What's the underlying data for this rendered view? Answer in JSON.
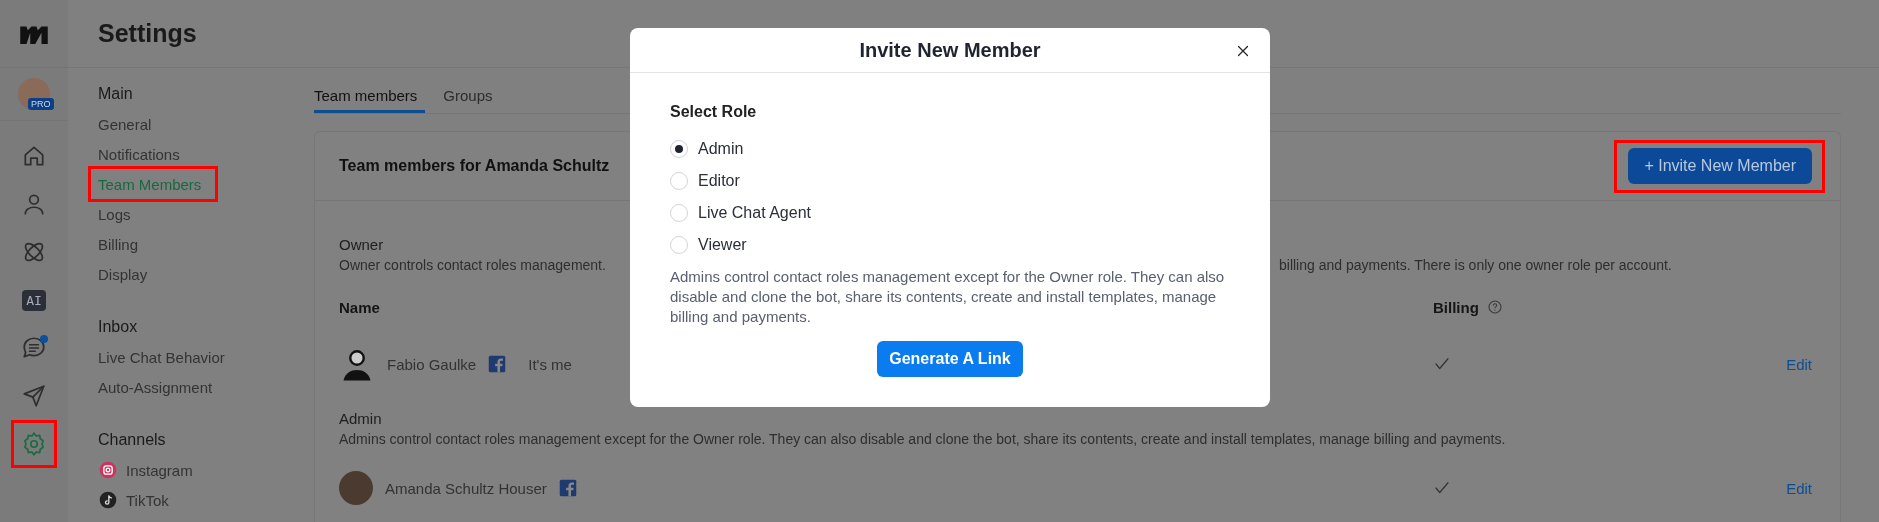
{
  "rail": {
    "avatar": {
      "badge": "PRO"
    },
    "items": [
      {
        "kind": "home",
        "selected": false,
        "highlighted": false,
        "notification": false
      },
      {
        "kind": "person",
        "selected": false,
        "highlighted": false,
        "notification": false
      },
      {
        "kind": "atom",
        "selected": false,
        "highlighted": false,
        "notification": false
      },
      {
        "kind": "ai",
        "label": "AI",
        "selected": false,
        "highlighted": false,
        "notification": false
      },
      {
        "kind": "chat",
        "selected": false,
        "highlighted": false,
        "notification": true
      },
      {
        "kind": "send",
        "selected": false,
        "highlighted": false,
        "notification": false
      },
      {
        "kind": "settings",
        "selected": true,
        "highlighted": true,
        "notification": false
      }
    ]
  },
  "page_title": "Settings",
  "settings_nav": [
    {
      "title": "Main",
      "items": [
        {
          "label": "General",
          "selected": false,
          "highlighted": false
        },
        {
          "label": "Notifications",
          "selected": false,
          "highlighted": false
        },
        {
          "label": "Team Members",
          "selected": true,
          "highlighted": true
        },
        {
          "label": "Logs",
          "selected": false,
          "highlighted": false
        },
        {
          "label": "Billing",
          "selected": false,
          "highlighted": false
        },
        {
          "label": "Display",
          "selected": false,
          "highlighted": false
        }
      ]
    },
    {
      "title": "Inbox",
      "items": [
        {
          "label": "Live Chat Behavior",
          "selected": false,
          "highlighted": false
        },
        {
          "label": "Auto-Assignment",
          "selected": false,
          "highlighted": false
        }
      ]
    },
    {
      "title": "Channels",
      "items": [
        {
          "label": "Instagram",
          "kind": "instagram",
          "selected": false,
          "highlighted": false
        },
        {
          "label": "TikTok",
          "kind": "tiktok",
          "selected": false,
          "highlighted": false
        }
      ]
    }
  ],
  "tabs": [
    {
      "label": "Team members",
      "selected": true
    },
    {
      "label": "Groups",
      "selected": false
    }
  ],
  "card": {
    "title": "Team members for Amanda Schultz",
    "invite_button": {
      "label": "+ Invite New Member",
      "highlighted": true
    },
    "roles": [
      {
        "title": "Owner",
        "description": [
          "Owner controls contact roles management.",
          "billing and payments. There is only one owner role per account."
        ],
        "columns": [
          {
            "label": "Name",
            "help": false
          },
          {
            "label": "Billing",
            "help": true
          }
        ],
        "members": [
          {
            "name": "Fabio Gaulke",
            "note": "It's me",
            "billing": true,
            "action": "Edit"
          }
        ]
      },
      {
        "title": "Admin",
        "description": [
          "Admins control contact roles management except for the Owner role. They can also disable and clone the bot, share its contents, create and install templates, manage billing and payments."
        ],
        "members": [
          {
            "name": "Amanda Schultz Houser",
            "billing": true,
            "action": "Edit"
          }
        ]
      }
    ]
  },
  "modal": {
    "title": "Invite New Member",
    "section_label": "Select Role",
    "roles": [
      {
        "label": "Admin",
        "selected": true
      },
      {
        "label": "Editor",
        "selected": false
      },
      {
        "label": "Live Chat Agent",
        "selected": false
      },
      {
        "label": "Viewer",
        "selected": false
      }
    ],
    "description": "Admins control contact roles management except for the Owner role. They can also disable and clone the bot, share its contents, create and install templates, manage billing and payments.",
    "button": "Generate A Link"
  }
}
